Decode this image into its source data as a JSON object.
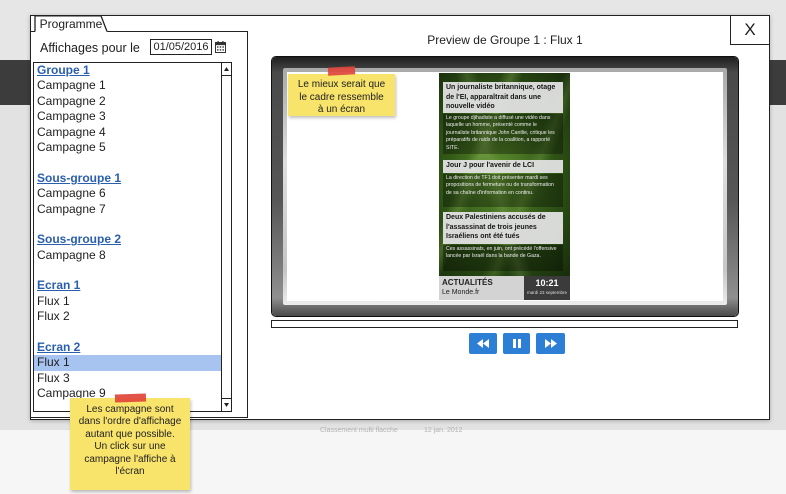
{
  "background": {
    "row_title": "Classement multi flacche",
    "row_date": "12 jan. 2012"
  },
  "dialog": {
    "close_label": "X"
  },
  "programme": {
    "tab_label": "Programme",
    "date_label": "Affichages pour le",
    "date_value": "01/05/2016",
    "calendar_icon": "calendar-icon",
    "groups": [
      {
        "label": "Groupe 1",
        "items": [
          "Campagne 1",
          "Campagne 2",
          "Campagne 3",
          "Campagne 4",
          "Campagne 5"
        ]
      },
      {
        "label": "Sous-groupe 1",
        "items": [
          "Campagne 6",
          "Campagne 7"
        ]
      },
      {
        "label": "Sous-groupe 2",
        "items": [
          "Campagne 8"
        ]
      },
      {
        "label": "Ecran 1",
        "items": [
          "Flux 1",
          "Flux 2"
        ]
      },
      {
        "label": "Ecran 2",
        "items": [
          "Flux 1",
          "Flux 3",
          "Campagne 9"
        ]
      }
    ],
    "selected": {
      "group_index": 4,
      "item_index": 0
    },
    "scroll_icons": [
      "scroll-up-icon",
      "scroll-down-icon"
    ]
  },
  "preview": {
    "title": "Preview de Groupe 1 : Flux 1",
    "note": "Le mieux serait que\nle cadre ressemble\nà un écran",
    "content": {
      "news": [
        {
          "headline": "Un journaliste britannique, otage de l'EI, apparaîtrait dans une nouvelle vidéo",
          "summary": "Le groupe djihadiste a diffusé une vidéo dans laquelle un homme, présenté comme le journaliste britannique John Cantlie, critique les préparatifs de raids de la coalition, a rapporté SITE."
        },
        {
          "headline": "Jour J pour l'avenir de LCI",
          "summary": "La direction de TF1 doit présenter mardi ses propositions de fermeture ou de transformation de sa chaîne d'information en continu."
        },
        {
          "headline": "Deux Palestiniens accusés de l'assassinat de trois jeunes Israéliens ont été tués",
          "summary": "Ces assassinats, en juin, ont précédé l'offensive lancée par Israël dans la bande de Gaza."
        }
      ],
      "footer": {
        "section": "ACTUALITÉS",
        "source": "Le Monde.fr",
        "time": "10:21",
        "date": "mardi 23 septembre"
      }
    },
    "progress": 0,
    "controls": {
      "rewind": "rewind-icon",
      "pause": "pause-icon",
      "forward": "fast-forward-icon"
    }
  },
  "help_note": "Les campagne sont\ndans l'ordre d'affichage\nautant que possible.\nUn click sur une\ncampagne l'affiche à\nl'écran",
  "colors": {
    "accent": "#2d7fd5",
    "link": "#2a5fae",
    "selection": "#a7c3ef",
    "sticky": "#f8e36b",
    "tape": "#e0453a"
  }
}
